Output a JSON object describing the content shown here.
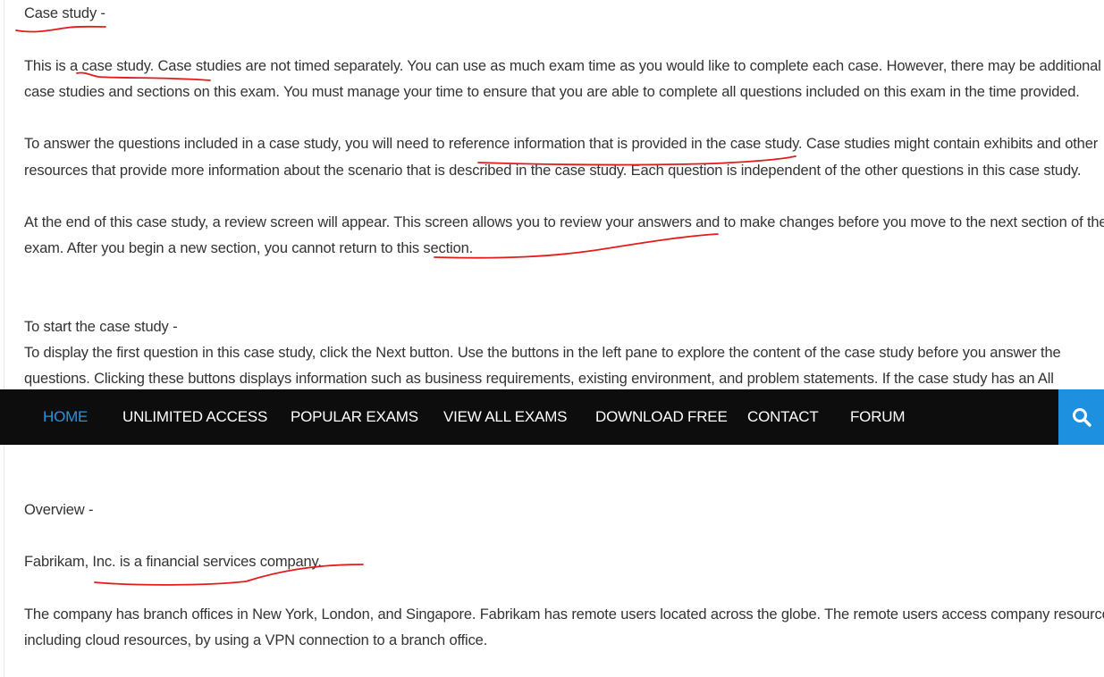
{
  "intro": {
    "heading": "Case study -",
    "p1_line1": "This is a case study. Case studies are not timed separately. You can use as much exam time as you would like to complete each case. However, there may be additional",
    "p1_line2": "case studies and sections on this exam. You must manage your time to ensure that you are able to complete all questions included on this exam in the time provided.",
    "p2_line1": "To answer the questions included in a case study, you will need to reference information that is provided in the case study. Case studies might contain exhibits and other",
    "p2_line2": "resources that provide more information about the scenario that is described in the case study. Each question is independent of the other questions in this case study.",
    "p3_line1": "At the end of this case study, a review screen will appear. This screen allows you to review your answers and to make changes before you move to the next section of the",
    "p3_line2": "exam. After you begin a new section, you cannot return to this section."
  },
  "start": {
    "heading": "To start the case study -",
    "line1": "To display the first question in this case study, click the Next button. Use the buttons in the left pane to explore the content of the case study before you answer the",
    "line2": "questions. Clicking these buttons displays information such as business requirements, existing environment, and problem statements. If the case study has an All"
  },
  "nav": {
    "items": [
      {
        "label": "HOME"
      },
      {
        "label": "UNLIMITED ACCESS"
      },
      {
        "label": "POPULAR EXAMS"
      },
      {
        "label": "VIEW ALL EXAMS"
      },
      {
        "label": "DOWNLOAD FREE"
      },
      {
        "label": "CONTACT"
      },
      {
        "label": "FORUM"
      }
    ],
    "search_icon": "search-icon",
    "active_color": "#2196e3",
    "search_bg": "#1e90e0"
  },
  "overview": {
    "heading": "Overview -",
    "line1": "Fabrikam, Inc. is a financial services company.",
    "para_line1": "The company has branch offices in New York, London, and Singapore. Fabrikam has remote users located across the globe. The remote users access company resources,",
    "para_line2": "including cloud resources, by using a VPN connection to a branch office."
  },
  "annotation_color": "#e31b1b"
}
